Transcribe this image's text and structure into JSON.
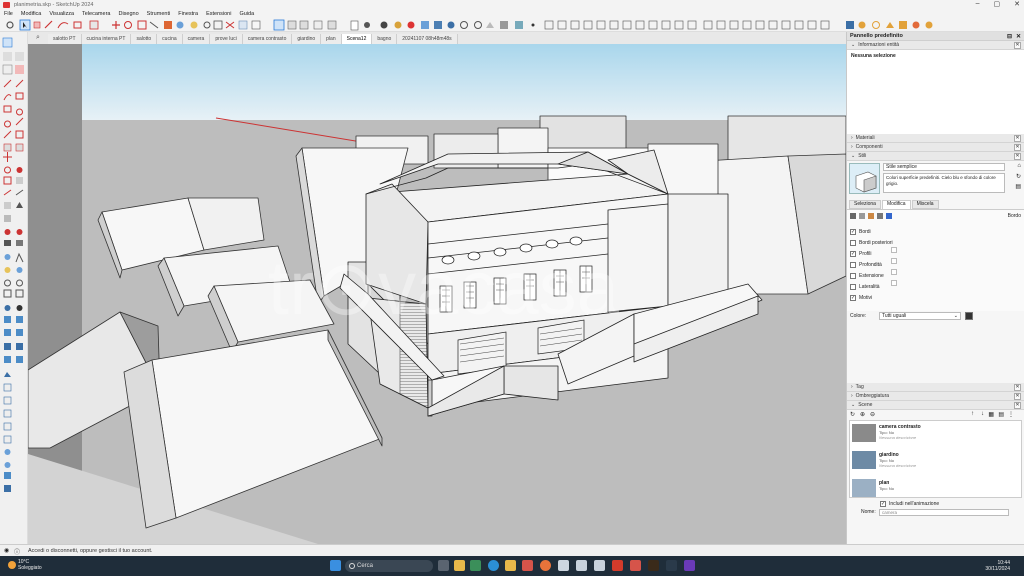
{
  "window": {
    "title": "planimetria.skp - SketchUp 2024"
  },
  "menu": [
    "File",
    "Modifica",
    "Visualizza",
    "Telecamera",
    "Disegno",
    "Strumenti",
    "Finestra",
    "Estensioni",
    "Guida"
  ],
  "scene_tabs": [
    "salotto PT",
    "cucina interna PT",
    "salotto",
    "cucina",
    "camera",
    "prove luci",
    "camera contrasto",
    "giardino",
    "plan",
    "Scena12",
    "bagno",
    "20241107 08h48m48s"
  ],
  "active_tab": "Scena12",
  "watermark": "tr⊙vacasa",
  "panel": {
    "title": "Pannello predefinito",
    "entity_info": {
      "header": "Informazioni entità",
      "selection": "Nessuna selezione"
    },
    "materials": "Materiali",
    "components": "Componenti",
    "styles": {
      "header": "Stili",
      "name": "Stile semplice",
      "description": "Colori superficie predefiniti. Cielo blu e sfondo di colore grigio.",
      "tabs": [
        "Seleziona",
        "Modifica",
        "Miscela"
      ],
      "active_tab": "Modifica",
      "section_label": "Bordo",
      "options": [
        {
          "label": "Bordi",
          "checked": true
        },
        {
          "label": "Bordi posteriori",
          "checked": false
        },
        {
          "label": "Profili",
          "checked": true
        },
        {
          "label": "Profondità",
          "checked": false
        },
        {
          "label": "Estensione",
          "checked": false
        },
        {
          "label": "Lateralità",
          "checked": false
        },
        {
          "label": "Motivi",
          "checked": true
        }
      ],
      "color_label": "Colore:",
      "color_value": "Tutti uguali"
    },
    "tags": "Tag",
    "shadows": "Ombreggiatura",
    "scenes": {
      "header": "Scene",
      "items": [
        {
          "name": "camera contrasto",
          "meta": "Tipo: No",
          "note": "Nessuna descrizione"
        },
        {
          "name": "giardino",
          "meta": "Tipo: No",
          "note": "Nessuna descrizione"
        },
        {
          "name": "plan",
          "meta": "Tipo: No",
          "note": ""
        }
      ],
      "include_label": "Includi nell'animazione",
      "name_label": "Nome:",
      "name_value": "camera"
    }
  },
  "status": {
    "text": "Accedi o disconnetti, oppure gestisci il tuo account."
  },
  "taskbar": {
    "weather_temp": "10°C",
    "weather_desc": "Soleggiato",
    "search": "Cerca",
    "time": "10:44",
    "date": "30/11/2024"
  },
  "colors": {
    "sky_top": "#a9d6ec",
    "sky_bottom": "#e7f1f6",
    "ground": "#bdbdbd",
    "taskbar": "#1f2d3a",
    "accent": "#2b7bd6"
  }
}
